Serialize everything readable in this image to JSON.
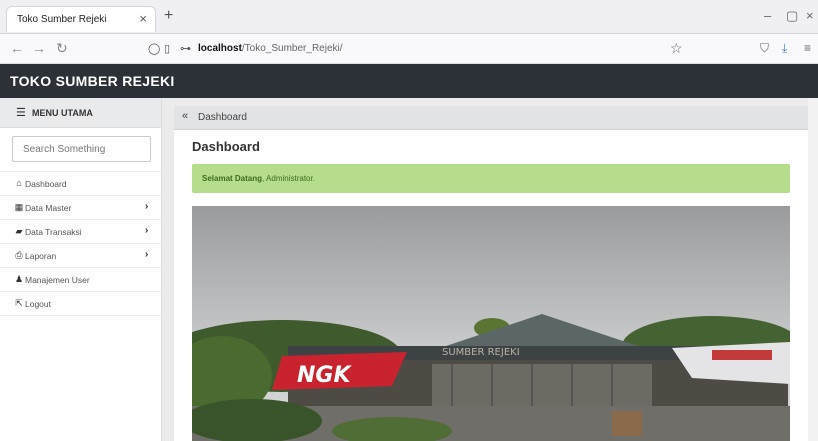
{
  "browser": {
    "tab_title": "Toko Sumber Rejeki",
    "tab_close": "×",
    "new_tab": "+",
    "url_host": "localhost",
    "url_path": "/Toko_Sumber_Rejeki/",
    "window_minimize": "–",
    "window_restore": "▢",
    "window_close": "×"
  },
  "app": {
    "brand": "TOKO SUMBER REJEKI"
  },
  "sidebar": {
    "header": "MENU UTAMA",
    "search_placeholder": "Search Something",
    "items": [
      {
        "label": "Dashboard",
        "icon": "home-icon",
        "has_submenu": false
      },
      {
        "label": "Data Master",
        "icon": "grid-icon",
        "has_submenu": true
      },
      {
        "label": "Data Transaksi",
        "icon": "folder-icon",
        "has_submenu": true
      },
      {
        "label": "Laporan",
        "icon": "print-icon",
        "has_submenu": true
      },
      {
        "label": "Manajemen User",
        "icon": "user-icon",
        "has_submenu": false
      },
      {
        "label": "Logout",
        "icon": "logout-icon",
        "has_submenu": false
      }
    ]
  },
  "main": {
    "breadcrumb": "Dashboard",
    "page_title": "Dashboard",
    "alert_bold": "Selamat Datang",
    "alert_rest": ", Administrator.",
    "photo_sign_ngk": "NGK",
    "photo_sign_store": "SUMBER REJEKI"
  },
  "colors": {
    "header_bg": "#2c3037",
    "alert_bg": "#b5dd8c",
    "alert_text": "#3c6d1c"
  }
}
